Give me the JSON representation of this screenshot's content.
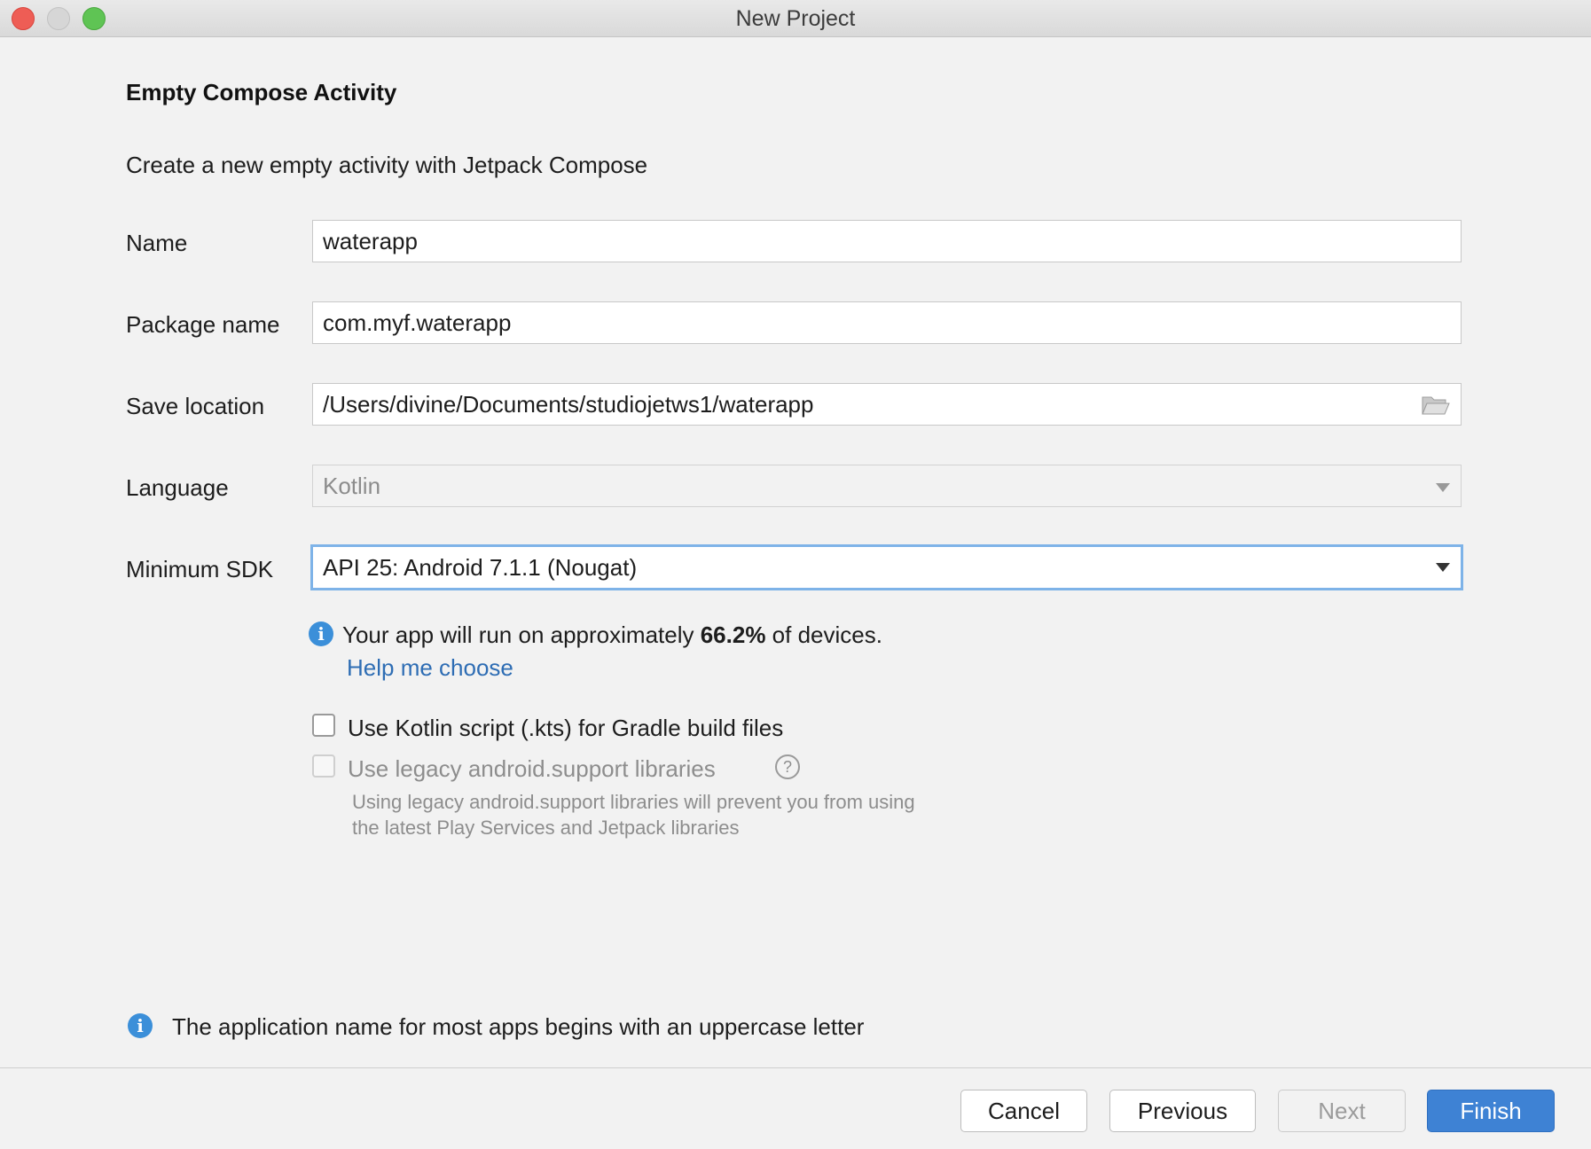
{
  "window": {
    "title": "New Project"
  },
  "page": {
    "heading": "Empty Compose Activity",
    "subtitle": "Create a new empty activity with Jetpack Compose"
  },
  "form": {
    "name": {
      "label": "Name",
      "value": "waterapp"
    },
    "package": {
      "label": "Package name",
      "value": "com.myf.waterapp"
    },
    "location": {
      "label": "Save location",
      "value": "/Users/divine/Documents/studiojetws1/waterapp"
    },
    "language": {
      "label": "Language",
      "value": "Kotlin"
    },
    "min_sdk": {
      "label": "Minimum SDK",
      "value": "API 25: Android 7.1.1 (Nougat)"
    }
  },
  "sdk_info": {
    "prefix": "Your app will run on approximately ",
    "percent": "66.2%",
    "suffix": " of devices.",
    "help_link": "Help me choose"
  },
  "options": {
    "kts": {
      "label": "Use Kotlin script (.kts) for Gradle build files",
      "checked": false
    },
    "legacy": {
      "label": "Use legacy android.support libraries",
      "checked": false,
      "hint_line1": "Using legacy android.support libraries will prevent you from using",
      "hint_line2": "the latest Play Services and Jetpack libraries"
    }
  },
  "footer_info": "The application name for most apps begins with an uppercase letter",
  "buttons": {
    "cancel": "Cancel",
    "previous": "Previous",
    "next": "Next",
    "finish": "Finish"
  },
  "colors": {
    "accent": "#3e82d4",
    "link": "#2e6db4",
    "info": "#3b8fd9"
  }
}
